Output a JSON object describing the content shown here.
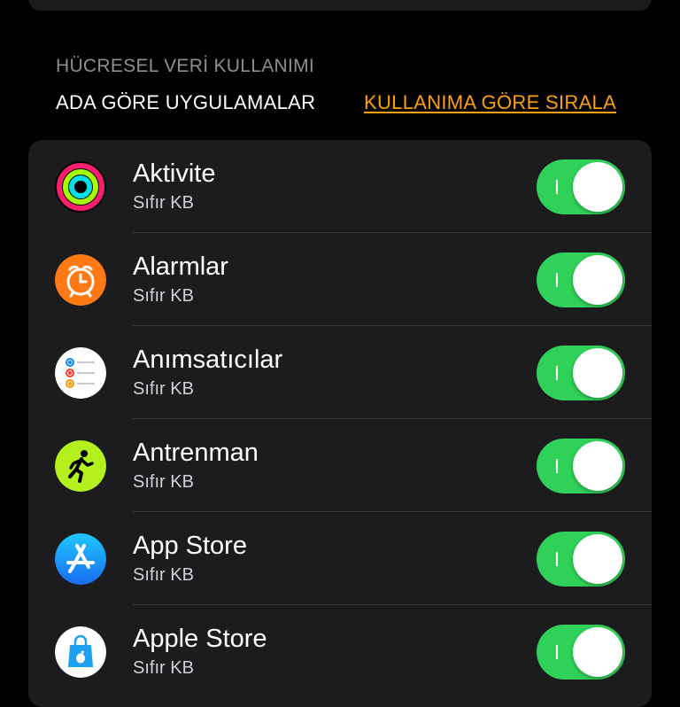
{
  "section": {
    "header": "HÜCRESEL VERİ KULLANIMI",
    "sort_label": "ADA GÖRE UYGULAMALAR",
    "sort_link": "KULLANIMA GÖRE SIRALA"
  },
  "apps": [
    {
      "name": "Aktivite",
      "usage": "Sıfır KB",
      "icon": "activity-icon",
      "enabled": true
    },
    {
      "name": "Alarmlar",
      "usage": "Sıfır KB",
      "icon": "alarm-clock-icon",
      "enabled": true
    },
    {
      "name": "Anımsatıcılar",
      "usage": "Sıfır KB",
      "icon": "reminders-icon",
      "enabled": true
    },
    {
      "name": "Antrenman",
      "usage": "Sıfır KB",
      "icon": "workout-icon",
      "enabled": true
    },
    {
      "name": "App Store",
      "usage": "Sıfır KB",
      "icon": "app-store-icon",
      "enabled": true
    },
    {
      "name": "Apple Store",
      "usage": "Sıfır KB",
      "icon": "apple-store-icon",
      "enabled": true
    }
  ],
  "colors": {
    "background": "#000000",
    "card": "#1c1c1e",
    "accent": "#ff9f0a",
    "toggle_on": "#30d158"
  }
}
